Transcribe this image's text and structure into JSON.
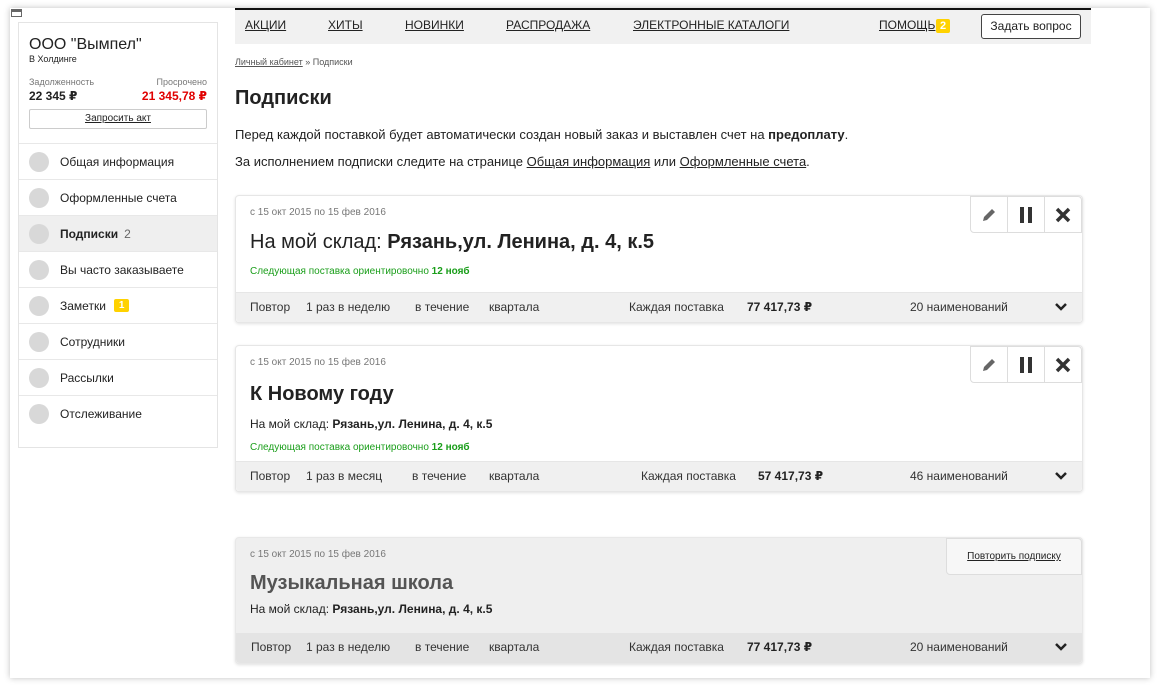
{
  "company": {
    "name": "ООО \"Вымпел\"",
    "sub": "В Холдинге",
    "debt_label": "Задолженность",
    "debt_value": "22 345 ₽",
    "overdue_label": "Просрочено",
    "overdue_value": "21 345,78 ₽",
    "request_act": "Запросить акт"
  },
  "menu": [
    {
      "label": "Общая информация"
    },
    {
      "label": "Оформленные счета"
    },
    {
      "label": "Подписки",
      "count": "2"
    },
    {
      "label": "Вы часто заказываете"
    },
    {
      "label": "Заметки",
      "badge": "1"
    },
    {
      "label": "Сотрудники"
    },
    {
      "label": "Рассылки"
    },
    {
      "label": "Отслеживание"
    }
  ],
  "topnav": {
    "items": [
      "АКЦИИ",
      "ХИТЫ",
      "НОВИНКИ",
      "РАСПРОДАЖА",
      "ЭЛЕКТРОННЫЕ КАТАЛОГИ"
    ],
    "help": "ПОМОЩЬ",
    "help_badge": "2",
    "ask": "Задать вопрос"
  },
  "breadcrumb": {
    "link": "Личный кабинет",
    "sep": " » ",
    "current": "Подписки"
  },
  "page_title": "Подписки",
  "intro1": {
    "before": "Перед каждой поставкой будет автоматически создан новый заказ и выставлен счет на ",
    "bold": "предоплату",
    "after": "."
  },
  "intro2": {
    "before": "За исполнением подписки следите на странице ",
    "link1": "Общая информация",
    "mid": " или ",
    "link2": "Оформленные счета",
    "after": "."
  },
  "cards": [
    {
      "period": "с 15 окт 2015 по 15 фев 2016",
      "title_prefix": "На мой склад: ",
      "title_bold": "Рязань,ул. Ленина, д. 4, к.5",
      "next_label": "Следующая поставка ориентировочно ",
      "next_date": "12 нояб",
      "repeat": "Повтор",
      "freq": "1 раз в неделю",
      "during": "в течение",
      "duration": "квартала",
      "each_label": "Каждая поставка",
      "each_sum": "77 417,73 ₽",
      "items": "20 наименований"
    },
    {
      "period": "с 15 окт 2015 по 15 фев 2016",
      "title": "К Новому году",
      "addr_label": "На мой склад: ",
      "addr": "Рязань,ул. Ленина, д. 4, к.5",
      "next_label": "Следующая поставка ориентировочно ",
      "next_date": "12 нояб",
      "repeat": "Повтор",
      "freq": "1 раз в месяц",
      "during": "в течение",
      "duration": "квартала",
      "each_label": "Каждая поставка",
      "each_sum": "57 417,73 ₽",
      "items": "46 наименований"
    },
    {
      "period": "с 15 окт 2015 по 15 фев 2016",
      "title": "Музыкальная школа",
      "addr_label": "На мой склад: ",
      "addr": "Рязань,ул. Ленина, д. 4, к.5",
      "repeat_button": "Повторить подписку",
      "repeat": "Повтор",
      "freq": "1 раз в неделю",
      "during": "в течение",
      "duration": "квартала",
      "each_label": "Каждая поставка",
      "each_sum": "77 417,73 ₽",
      "items": "20 наименований"
    }
  ],
  "colors": {
    "accent_badge": "#ffd200",
    "overdue": "#e00000",
    "next_green": "#1a9e1a"
  }
}
